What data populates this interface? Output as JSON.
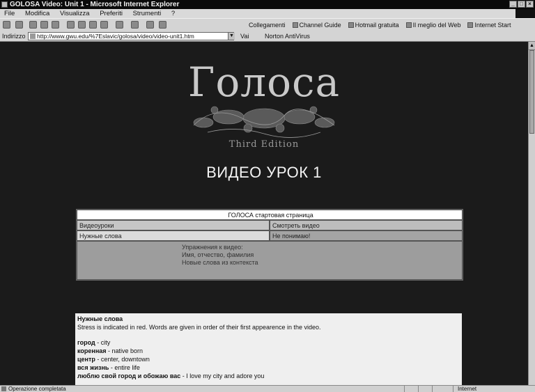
{
  "window": {
    "title": "GOLOSA Video: Unit 1 - Microsoft Internet Explorer",
    "buttons": [
      "_",
      "□",
      "×"
    ]
  },
  "menu": [
    "File",
    "Modifica",
    "Visualizza",
    "Preferiti",
    "Strumenti",
    "?"
  ],
  "toolbar": {
    "icons": [
      "back-icon",
      "forward-icon",
      "stop-icon",
      "refresh-icon",
      "home-icon",
      "search-icon",
      "favorites-icon",
      "history-icon",
      "mail-icon",
      "print-icon",
      "edit-icon"
    ],
    "links": [
      "Collegamenti",
      "Channel Guide",
      "Hotmail gratuita",
      "Il meglio del Web",
      "Internet Start"
    ]
  },
  "address": {
    "label": "Indirizzo",
    "url": "http://www.gwu.edu/%7Eslavic/golosa/video/video-unit1.htm",
    "go": "Vai",
    "norton": "Norton AntiVirus"
  },
  "page": {
    "logo_text": "Голоса",
    "edition": "Third Edition",
    "title": "ВИДЕО УРОК 1",
    "nav": {
      "home": "ГОЛОСА стартовая страница",
      "video_lessons": "Видеоуроки",
      "watch_video": "Смотреть видео",
      "needed_words": "Нужные слова",
      "not_understood": "Не понимаю!",
      "exercises": [
        "Упражнения к видео:",
        "Имя, отчество, фамилия",
        "Новые слова из контекста"
      ]
    },
    "vocab": {
      "heading": "Нужные слова",
      "note": "Stress is indicated in red. Words are given in order of their first appearence in the video.",
      "entries": [
        {
          "word": "город",
          "def": " - city"
        },
        {
          "word": "коренная",
          "def": " - native born"
        },
        {
          "word": "центр",
          "def": " - center, downtown"
        },
        {
          "word": "вся жизнь",
          "def": " - entire life"
        },
        {
          "word": "люблю свой город и обожаю вас",
          "def": " - I love my city and adore you"
        }
      ]
    }
  },
  "status": {
    "text": "Operazione completata",
    "zone": "Internet"
  }
}
